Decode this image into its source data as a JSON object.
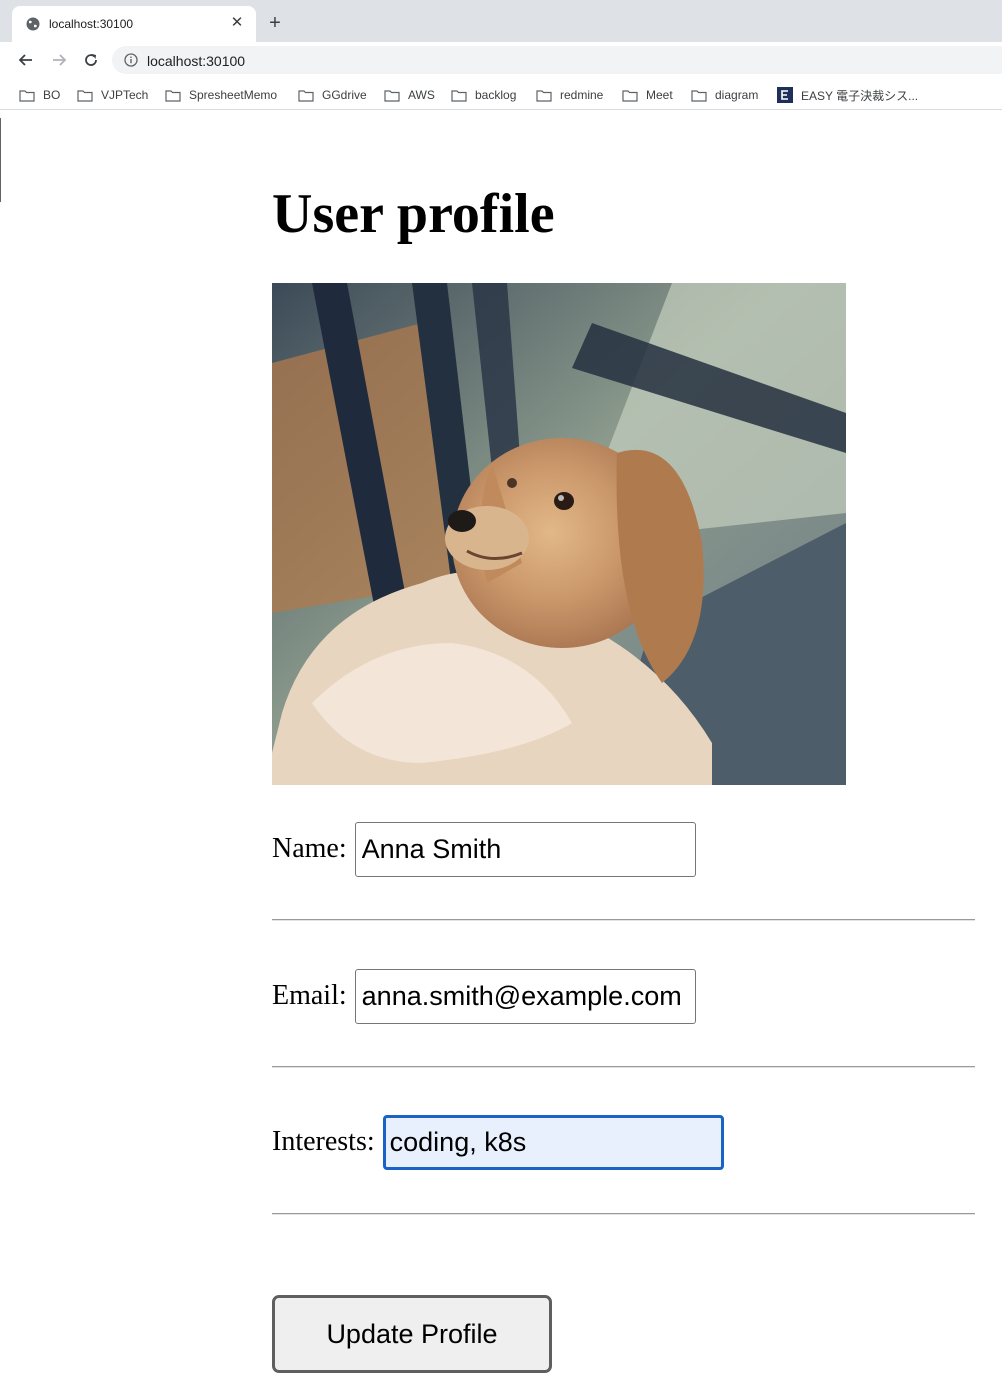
{
  "browser": {
    "tab_title": "localhost:30100",
    "url": "localhost:30100",
    "bookmarks": [
      "BO",
      "VJPTech",
      "SpresheetMemo",
      "GGdrive",
      "AWS",
      "backlog",
      "redmine",
      "Meet",
      "diagram",
      "EASY 電子決裁シス..."
    ]
  },
  "page": {
    "title": "User profile",
    "photo_alt": "dog-photo"
  },
  "form": {
    "name_label": "Name:",
    "name_value": "Anna Smith",
    "email_label": "Email:",
    "email_value": "anna.smith@example.com",
    "interests_label": "Interests:",
    "interests_value": "coding, k8s",
    "submit_label": "Update Profile"
  },
  "colors": {
    "focus_border": "#1a63c6",
    "focus_fill": "#e8f0fe"
  }
}
